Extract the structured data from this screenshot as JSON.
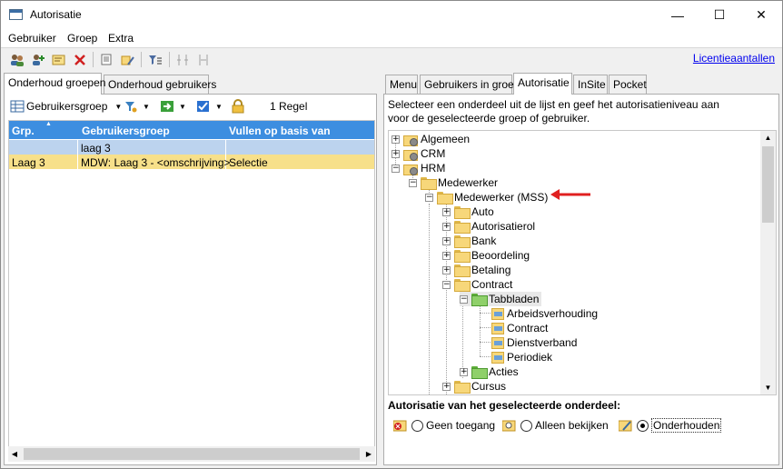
{
  "window": {
    "title": "Autorisatie",
    "minimize": "—",
    "maximize": "☐",
    "close": "✕"
  },
  "menu": [
    "Gebruiker",
    "Groep",
    "Extra"
  ],
  "toolbar": {
    "license_link": "Licentieaantallen"
  },
  "left_tabs": [
    "Onderhoud groepen",
    "Onderhoud gebruikers"
  ],
  "left_toolbar": {
    "group_button": "Gebruikersgroep",
    "row_count": "1 Regel"
  },
  "grid": {
    "columns": [
      "Grp.",
      "Gebruikersgroep",
      "Vullen op basis van"
    ],
    "filter_row": [
      "",
      "laag 3",
      ""
    ],
    "rows": [
      [
        "Laag 3",
        "MDW: Laag 3 - <omschrijving>",
        "Selectie"
      ]
    ]
  },
  "right_tabs": [
    "Menu",
    "Gebruikers in groep",
    "Autorisatie",
    "InSite",
    "Pocket"
  ],
  "instruction": "Selecteer een onderdeel uit de lijst en geef het autorisatieniveau aan voor de geselecteerde groep of gebruiker.",
  "tree": {
    "n0": "Algemeen",
    "n1": "CRM",
    "n2": "HRM",
    "n3": "Medewerker",
    "n4": "Medewerker (MSS)",
    "n5": "Auto",
    "n6": "Autorisatierol",
    "n7": "Bank",
    "n8": "Beoordeling",
    "n9": "Betaling",
    "n10": "Contract",
    "n11": "Tabbladen",
    "n12": "Arbeidsverhouding",
    "n13": "Contract",
    "n14": "Dienstverband",
    "n15": "Periodiek",
    "n16": "Acties",
    "n17": "Cursus"
  },
  "auth": {
    "label": "Autorisatie van het geselecteerde onderdeel:",
    "options": [
      "Geen toegang",
      "Alleen bekijken",
      "Onderhouden"
    ],
    "selected": "Onderhouden"
  },
  "colors": {
    "header_blue": "#3d8ee0",
    "selected_row": "#f7e08a",
    "filter_row": "#bcd3ee",
    "arrow_red": "#e02020"
  }
}
